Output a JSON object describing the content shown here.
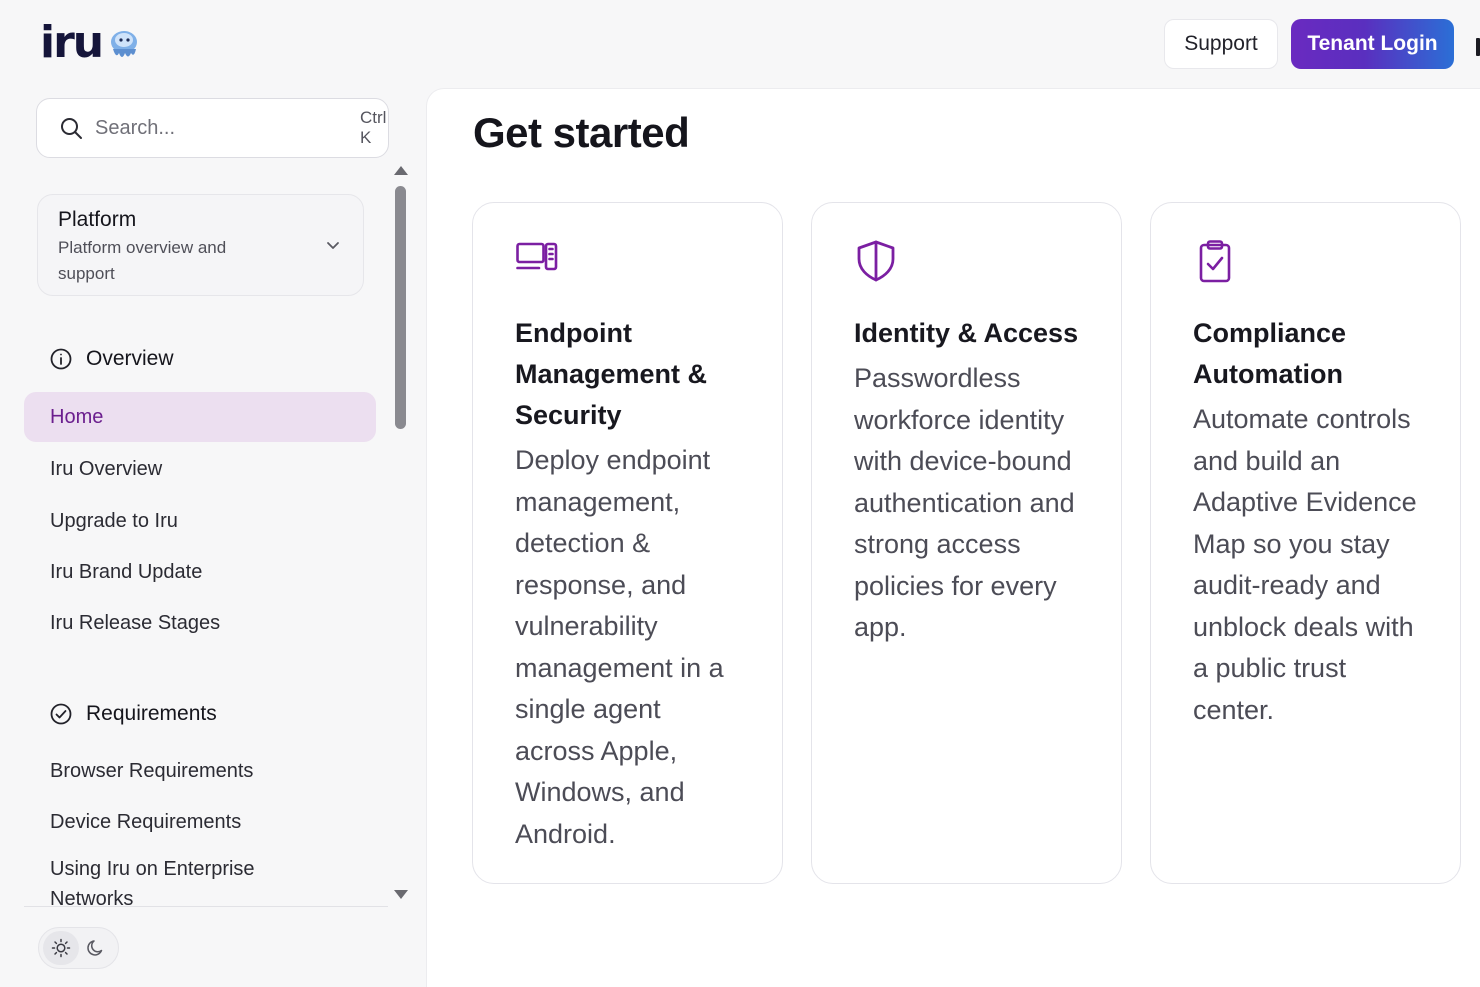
{
  "header": {
    "logo_text": "iru",
    "support_label": "Support",
    "login_label": "Tenant Login"
  },
  "search": {
    "placeholder": "Search...",
    "shortcut": "Ctrl K"
  },
  "platform": {
    "title": "Platform",
    "subtitle": "Platform overview and support"
  },
  "sidebar": {
    "overview_heading": "Overview",
    "overview_items": [
      "Home",
      "Iru Overview",
      "Upgrade to Iru",
      "Iru Brand Update",
      "Iru Release Stages"
    ],
    "active_item": "Home",
    "requirements_heading": "Requirements",
    "requirements_items": [
      "Browser Requirements",
      "Device Requirements",
      "Using Iru on Enterprise Networks"
    ]
  },
  "main": {
    "title": "Get started",
    "cards": [
      {
        "icon": "devices-icon",
        "title": "Endpoint Management & Security",
        "description": "Deploy endpoint management, detection & response, and vulnerability management in a single agent across Apple, Windows, and Android."
      },
      {
        "icon": "shield-icon",
        "title": "Identity & Access",
        "description": "Passwordless workforce identity with device-bound authentication and strong access policies for every app."
      },
      {
        "icon": "clipboard-check-icon",
        "title": "Compliance Automation",
        "description": "Automate controls and build an Adaptive Evidence Map so you stay audit-ready and unblock deals with a public trust center."
      }
    ]
  },
  "colors": {
    "accent": "#7b1fa2",
    "active_bg": "#ecdff0",
    "login_gradient_start": "#6a2ac0",
    "login_gradient_end": "#2b6fd6"
  }
}
